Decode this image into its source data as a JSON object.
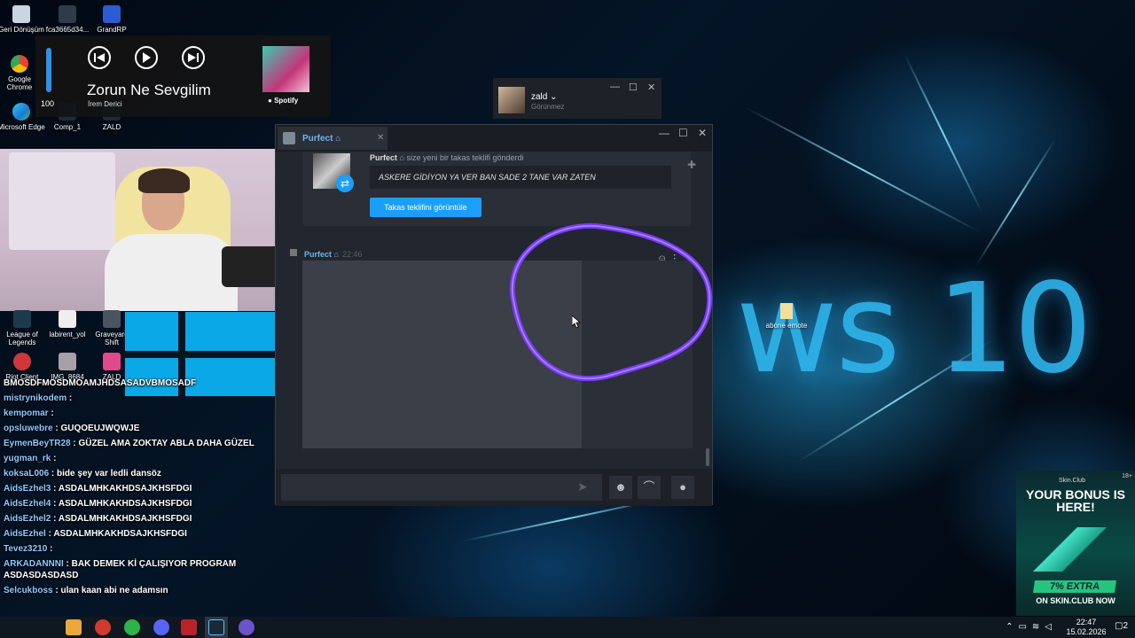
{
  "desktop": {
    "wallpaper_text": "ws 10",
    "icons_top": [
      {
        "label": "Geri Dönüşüm"
      },
      {
        "label": "fca3665d34..."
      },
      {
        "label": "GrandRP"
      },
      {
        "label": "Google Chrome"
      },
      {
        "label": "Microsoft Edge"
      },
      {
        "label": "Comp_1"
      },
      {
        "label": "ZALD"
      }
    ],
    "icons_mid": [
      {
        "label": "League of Legends"
      },
      {
        "label": "labirent_yol"
      },
      {
        "label": "Graveyard Shift"
      },
      {
        "label": "Riot Client"
      },
      {
        "label": "IMG_8684"
      },
      {
        "label": "ZALD"
      }
    ],
    "abone_label": "abone emote"
  },
  "media": {
    "volume": 100,
    "volume_label": "100",
    "title": "Zorun Ne Sevgilim",
    "artist": "İrem Derici",
    "source": "Spotify"
  },
  "chat": [
    {
      "user": "",
      "text": "BMOSDFMOSDMOAMJHDSASADVBMOSADF"
    },
    {
      "user": "mistrynikodem",
      "text": ""
    },
    {
      "user": "kempomar",
      "text": ""
    },
    {
      "user": "opsluwebre",
      "text": "GUQOEUJWQWJE"
    },
    {
      "user": "EymenBeyTR28",
      "text": "GÜZEL AMA ZOKTAY ABLA DAHA GÜZEL"
    },
    {
      "user": "yugman_rk",
      "text": ""
    },
    {
      "user": "koksaL006",
      "text": "bide şey var ledli dansöz"
    },
    {
      "user": "AidsEzhel3",
      "text": "ASDALMHKAKHDSAJKHSFDGI"
    },
    {
      "user": "AidsEzhel4",
      "text": "ASDALMHKAKHDSAJKHSFDGI"
    },
    {
      "user": "AidsEzhel2",
      "text": "ASDALMHKAKHDSAJKHSFDGI"
    },
    {
      "user": "AidsEzhel",
      "text": "ASDALMHKAKHDSAJKHSFDGI"
    },
    {
      "user": "Tevez3210",
      "text": ""
    },
    {
      "user": "ARKADANNNI",
      "text": "BAK DEMEK Kİ ÇALIŞIYOR PROGRAM ASDASDASDASD"
    },
    {
      "user": "Selcukboss",
      "text": "ulan kaan abi ne adamsın"
    }
  ],
  "friends": {
    "name": "zald",
    "status": "Görünmez"
  },
  "steam_chat": {
    "tab_name": "Purfect",
    "trade": {
      "sender": "Purfect",
      "header_suffix": "size yeni bir takas teklifi gönderdi",
      "message": "ASKERE GİDİYON YA VER BAN SADE 2 TANE VAR ZATEN",
      "button": "Takas teklifini görüntüle"
    },
    "message2": {
      "sender": "Purfect",
      "time": "22:46"
    },
    "input_placeholder": ""
  },
  "ad": {
    "logo": "Skin.Club",
    "headline": "YOUR BONUS IS HERE!",
    "badge": "7% EXTRA",
    "footer": "ON SKIN.CLUB NOW",
    "corner": "18+"
  },
  "taskbar": {
    "time": "22:47",
    "date": "15.02.2026",
    "notif_count": "2"
  },
  "colors": {
    "steam_blue": "#1a9fff",
    "ring_purple": "#7b3cff"
  }
}
